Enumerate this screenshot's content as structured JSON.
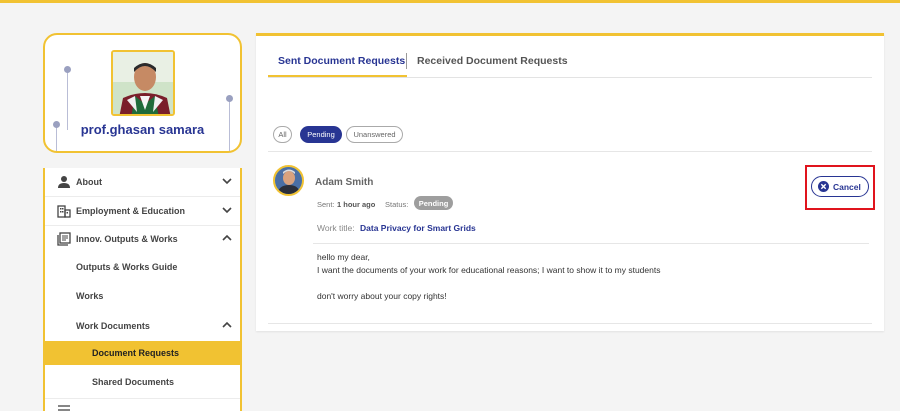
{
  "profile": {
    "name": "prof.ghasan samara"
  },
  "sidebar": {
    "items": [
      {
        "label": "About",
        "icon": "person-icon",
        "expanded": false
      },
      {
        "label": "Employment & Education",
        "icon": "building-icon",
        "expanded": false
      },
      {
        "label": "Innov. Outputs & Works",
        "icon": "library-icon",
        "expanded": true
      },
      {
        "label": "Outputs & Works Guide"
      },
      {
        "label": "Works"
      },
      {
        "label": "Work Documents",
        "expanded": true
      },
      {
        "label": "Document Requests",
        "active": true
      },
      {
        "label": "Shared Documents"
      }
    ]
  },
  "tabs": [
    {
      "label": "Sent Document Requests",
      "active": true
    },
    {
      "label": "Received Document Requests",
      "active": false
    }
  ],
  "filters": [
    {
      "label": "All",
      "active": false
    },
    {
      "label": "Pending",
      "active": true
    },
    {
      "label": "Unanswered",
      "active": false
    }
  ],
  "request": {
    "name": "Adam Smith",
    "sent_label": "Sent:",
    "sent_value": "1 hour ago",
    "status_label": "Status:",
    "status_value": "Pending",
    "work_label": "Work title:",
    "work_title": "Data Privacy for Smart Grids",
    "message_lines": [
      "hello my dear,",
      "I want the documents of your work for educational reasons; I want to show it to my students",
      "don't worry about your copy rights!"
    ],
    "cancel_label": "Cancel"
  },
  "colors": {
    "accent": "#f1c232",
    "primary": "#283593",
    "highlight": "#e0141d"
  }
}
